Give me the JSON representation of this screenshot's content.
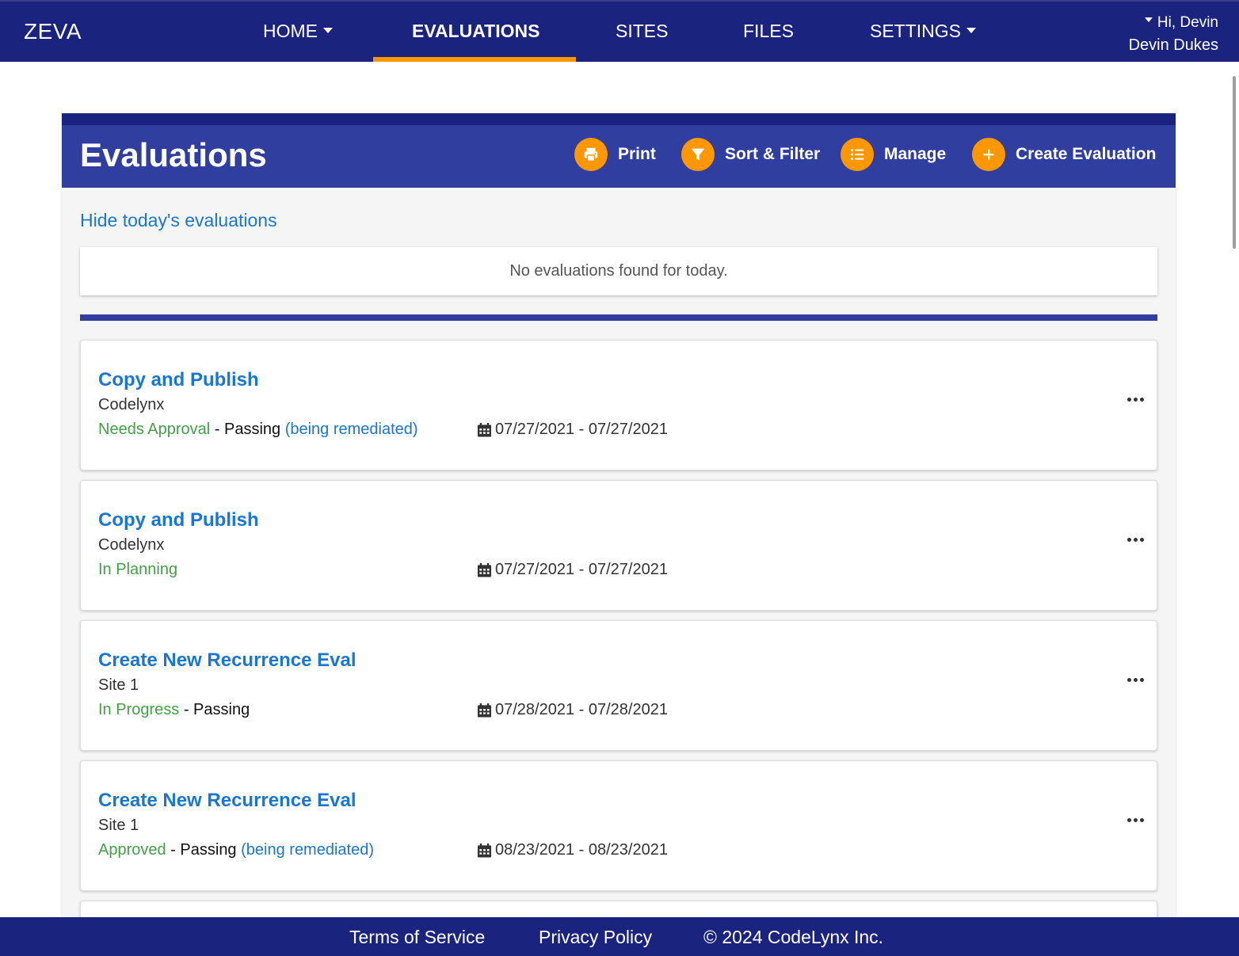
{
  "nav": {
    "brand": "ZEVA",
    "items": [
      {
        "label": "HOME",
        "dropdown": true
      },
      {
        "label": "EVALUATIONS",
        "active": true
      },
      {
        "label": "SITES"
      },
      {
        "label": "FILES"
      },
      {
        "label": "SETTINGS",
        "dropdown": true
      }
    ],
    "greeting": "Hi, Devin",
    "user_name": "Devin Dukes"
  },
  "panel": {
    "title": "Evaluations",
    "actions": [
      {
        "label": "Print",
        "icon": "print-icon"
      },
      {
        "label": "Sort & Filter",
        "icon": "filter-icon"
      },
      {
        "label": "Manage",
        "icon": "list-icon"
      },
      {
        "label": "Create Evaluation",
        "icon": "plus-icon"
      }
    ],
    "hide_today_link": "Hide today's evaluations",
    "today_empty_message": "No evaluations found for today."
  },
  "evaluations": [
    {
      "title": "Copy and Publish",
      "site": "Codelynx",
      "status": "Needs Approval",
      "sep": " - ",
      "result": "Passing",
      "remediation": "(being remediated)",
      "dates": "07/27/2021 - 07/27/2021"
    },
    {
      "title": "Copy and Publish",
      "site": "Codelynx",
      "status": "In Planning",
      "sep": "",
      "result": "",
      "remediation": "",
      "dates": "07/27/2021 - 07/27/2021"
    },
    {
      "title": "Create New Recurrence Eval",
      "site": "Site 1",
      "status": "In Progress",
      "sep": " - ",
      "result": "Passing",
      "remediation": "",
      "dates": "07/28/2021 - 07/28/2021"
    },
    {
      "title": "Create New Recurrence Eval",
      "site": "Site 1",
      "status": "Approved",
      "sep": " - ",
      "result": "Passing",
      "remediation": "(being remediated)",
      "dates": "08/23/2021 - 08/23/2021"
    }
  ],
  "footer": {
    "terms": "Terms of Service",
    "privacy": "Privacy Policy",
    "copyright": "© 2024 CodeLynx Inc."
  },
  "colors": {
    "nav_bg": "#1a237e",
    "header_bg": "#303f9f",
    "accent": "#ff9800",
    "link": "#1976d2",
    "status_green": "#43a047"
  }
}
